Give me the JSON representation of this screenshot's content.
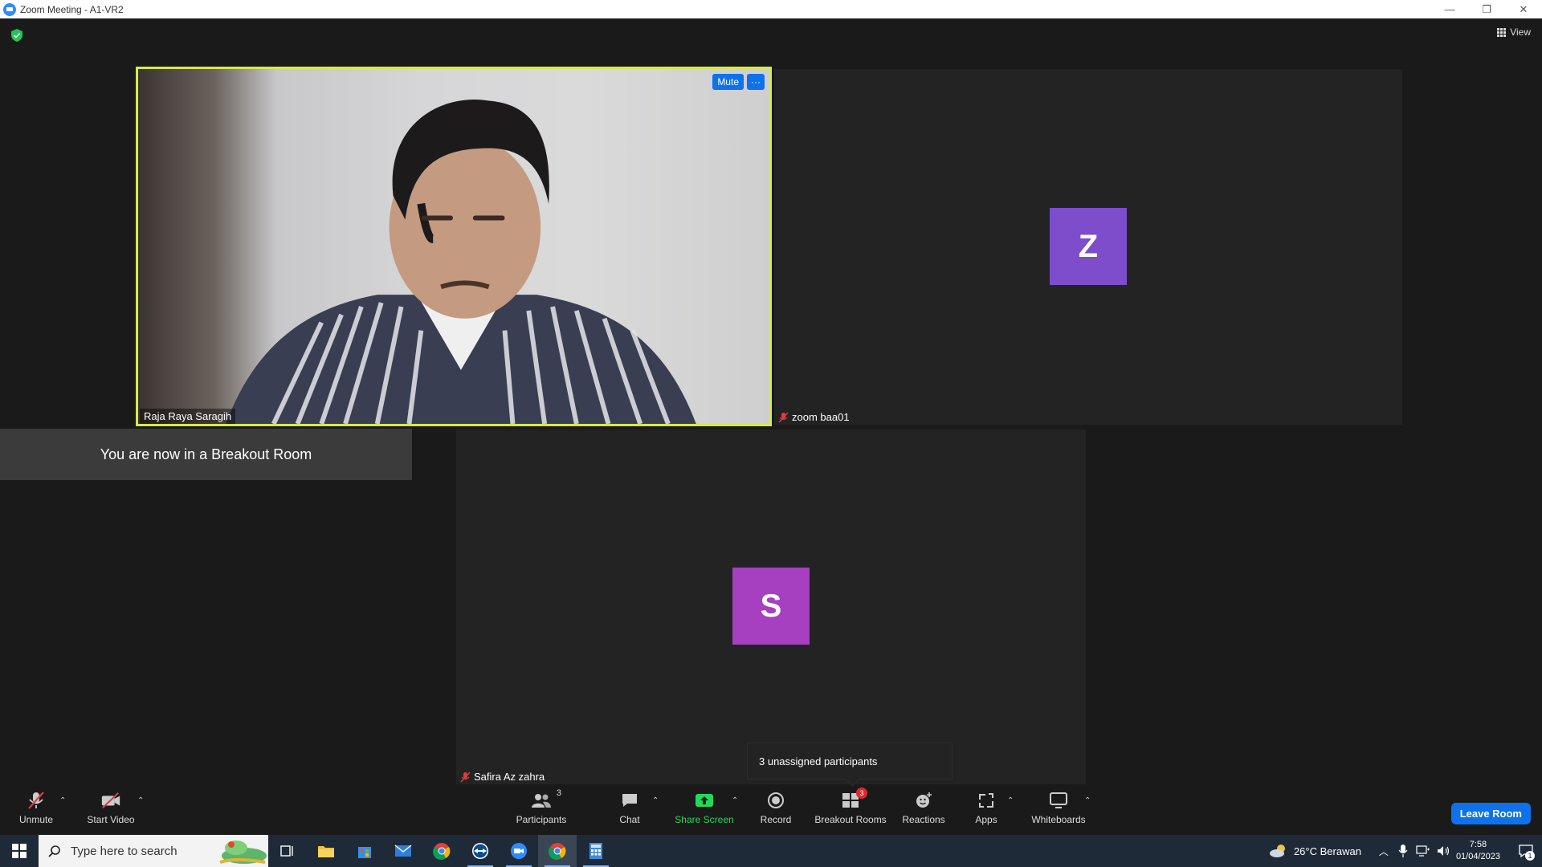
{
  "window": {
    "title": "Zoom Meeting - A1-VR2",
    "controls": [
      "—",
      "❐",
      "✕"
    ]
  },
  "top": {
    "view_label": "View"
  },
  "tiles": {
    "raja": {
      "name": "Raja Raya Saragih",
      "mute_label": "Mute",
      "more_label": "···"
    },
    "zoom": {
      "name": "zoom baa01",
      "initial": "Z",
      "color": "#7d4dcc",
      "mic": "muted"
    },
    "safira": {
      "name": "Safira Az zahra",
      "initial": "S",
      "color": "#a63fc0",
      "mic": "muted"
    }
  },
  "banner": {
    "text": "You are now in a Breakout Room"
  },
  "popover": {
    "text": "3 unassigned participants"
  },
  "toolbar": {
    "unmute": "Unmute",
    "start_video": "Start Video",
    "participants": "Participants",
    "participants_count": "3",
    "chat": "Chat",
    "share_screen": "Share Screen",
    "record": "Record",
    "breakout_rooms": "Breakout Rooms",
    "breakout_badge": "3",
    "reactions": "Reactions",
    "apps": "Apps",
    "whiteboards": "Whiteboards",
    "leave": "Leave Room",
    "share_color": "#23d959"
  },
  "taskbar": {
    "search_placeholder": "Type here to search",
    "weather": "26°C  Berawan",
    "time": "7:58",
    "date": "01/04/2023",
    "notification_count": "1"
  }
}
